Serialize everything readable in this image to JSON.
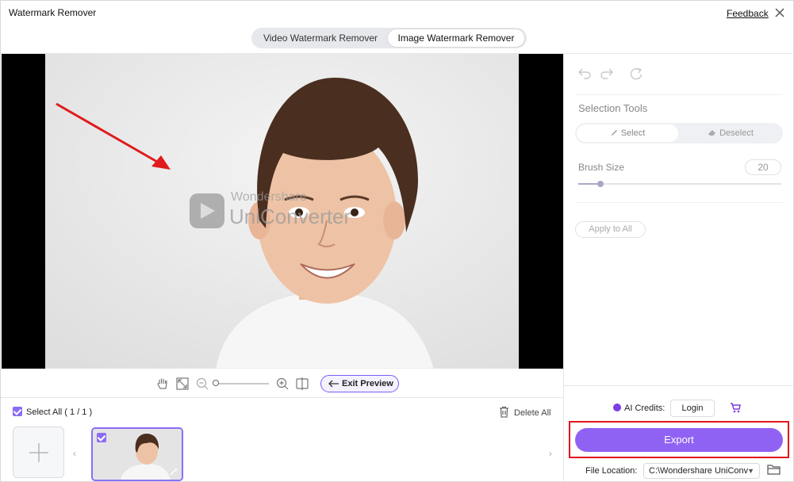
{
  "window": {
    "title": "Watermark Remover",
    "feedback_label": "Feedback",
    "close_icon": "close-icon"
  },
  "mode_tabs": [
    {
      "label": "Video Watermark Remover",
      "active": false
    },
    {
      "label": "Image Watermark Remover",
      "active": true
    }
  ],
  "preview": {
    "watermark_line1": "Wondershare",
    "watermark_line2": "UniConverter",
    "annotation_color": "#e01b1b"
  },
  "zoombar": {
    "icons": [
      "hand-icon",
      "fit-screen-icon",
      "zoom-out-icon",
      "zoom-in-icon",
      "compare-icon"
    ],
    "zoom_level": 0,
    "exit_preview_label": "Exit Preview"
  },
  "file_strip": {
    "select_all_label": "Select All ( 1 / 1 )",
    "delete_all_label": "Delete All",
    "selected_count": 1,
    "total_count": 1
  },
  "right_panel": {
    "selection_tools_label": "Selection Tools",
    "select_label": "Select",
    "deselect_label": "Deselect",
    "brush_size_label": "Brush Size",
    "brush_size_value": "20",
    "apply_to_all_label": "Apply to All",
    "ai_credits_label": "AI Credits:",
    "login_label": "Login",
    "export_label": "Export",
    "file_location_label": "File Location:",
    "file_location_value": "C:\\Wondershare UniConv"
  },
  "colors": {
    "accent": "#9062f3",
    "highlight_box": "#e0161d"
  }
}
